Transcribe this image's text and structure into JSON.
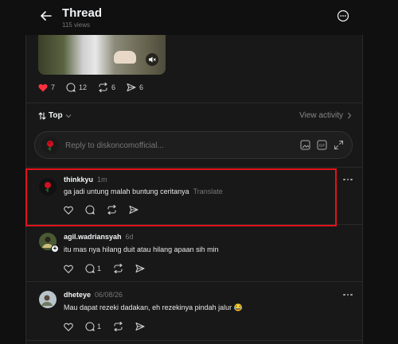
{
  "header": {
    "title": "Thread",
    "views": "115 views"
  },
  "post_actions": {
    "likes": "7",
    "replies": "12",
    "reposts": "6",
    "shares": "6"
  },
  "sort": {
    "label": "Top",
    "view_activity": "View activity"
  },
  "reply_box": {
    "placeholder": "Reply to diskoncomofficial..."
  },
  "comments": [
    {
      "username": "thinkkyu",
      "time": "1m",
      "text": "ga jadi untung malah buntung ceritanya",
      "translate": "Translate",
      "reply_count": "",
      "highlighted": true
    },
    {
      "username": "agil.wadriansyah",
      "time": "6d",
      "text": "itu mas nya hilang duit atau hilang apaan sih min",
      "reply_count": "1"
    },
    {
      "username": "dheteye",
      "time": "06/08/26",
      "text": "Mau dapat rezeki dadakan, eh rezekinya pindah jalur 😂",
      "reply_count": "1"
    }
  ],
  "colors": {
    "background": "#101010",
    "panel": "#181818",
    "like_red": "#ff3040",
    "highlight_box": "#e0141a"
  }
}
